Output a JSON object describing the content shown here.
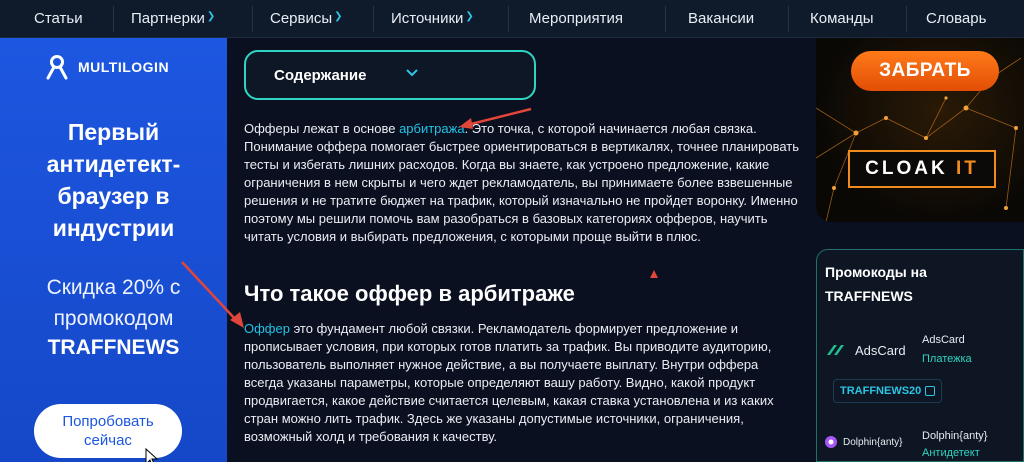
{
  "nav": {
    "items": [
      {
        "label": "Статьи",
        "has_dropdown": false
      },
      {
        "label": "Партнерки",
        "has_dropdown": true
      },
      {
        "label": "Сервисы",
        "has_dropdown": true
      },
      {
        "label": "Источники",
        "has_dropdown": true
      },
      {
        "label": "Мероприятия",
        "has_dropdown": false
      },
      {
        "label": "Вакансии",
        "has_dropdown": false
      },
      {
        "label": "Команды",
        "has_dropdown": false
      },
      {
        "label": "Словарь",
        "has_dropdown": false
      }
    ]
  },
  "left_ad": {
    "logo_text": "MULTILOGIN",
    "headline": [
      "Первый",
      "антидетект-",
      "браузер в",
      "индустрии"
    ],
    "promo_lines": [
      "Скидка 20% с",
      "промокодом"
    ],
    "promo_code": "TRAFFNEWS",
    "button_lines": [
      "Попробовать",
      "сейчас"
    ],
    "color": "#1d56e0"
  },
  "toc": {
    "label": "Содержание",
    "icon": "chevron-down-icon"
  },
  "article": {
    "p1": {
      "before": "Офферы лежат в основе ",
      "link": "арбитража",
      "after": ". Это точка, с которой начинается любая связка. Понимание оффера помогает быстрее ориентироваться в вертикалях, точнее планировать тесты и избегать лишних расходов. Когда вы знаете, как устроено предложение, какие ограничения в нем скрыты и чего ждет рекламодатель, вы принимаете более взвешенные решения и не тратите бюджет на трафик, который изначально не пройдет воронку. Именно поэтому мы решили помочь вам разобраться в базовых категориях офферов, научить читать условия и выбирать предложения, с которыми проще выйти в плюс."
    },
    "h2": "Что такое оффер в арбитраже",
    "p2": {
      "link": "Оффер",
      "after": " это фундамент любой связки. Рекламодатель формирует предложение и прописывает условия, при которых готов платить за трафик. Вы приводите аудиторию, пользователь выполняет нужное действие, а вы получаете выплату. Внутри оффера всегда указаны параметры, которые определяют вашу работу. Видно, какой продукт продвигается, какое действие считается целевым, какая ставка установлена и из каких стран можно лить трафик. Здесь же указаны допустимые источники, ограничения, возможный холд и требования к качеству."
    },
    "link_color": "#22c3e6"
  },
  "right_ad": {
    "button": "ЗАБРАТЬ",
    "brand_main": "CLOAK",
    "brand_accent": "IT",
    "accent_color": "#f08c1e"
  },
  "promocodes": {
    "title": "Промокоды на TRAFFNEWS",
    "entries": [
      {
        "logo_text": "AdsCard",
        "name": "AdsCard",
        "category": "Платежка",
        "code": "TRAFFNEWS20",
        "icon": "adscard-logo-icon"
      },
      {
        "logo_text": "Dolphin{anty}",
        "name": "Dolphin{anty}",
        "category": "Антидетект",
        "icon": "dolphin-logo-icon"
      }
    ]
  }
}
